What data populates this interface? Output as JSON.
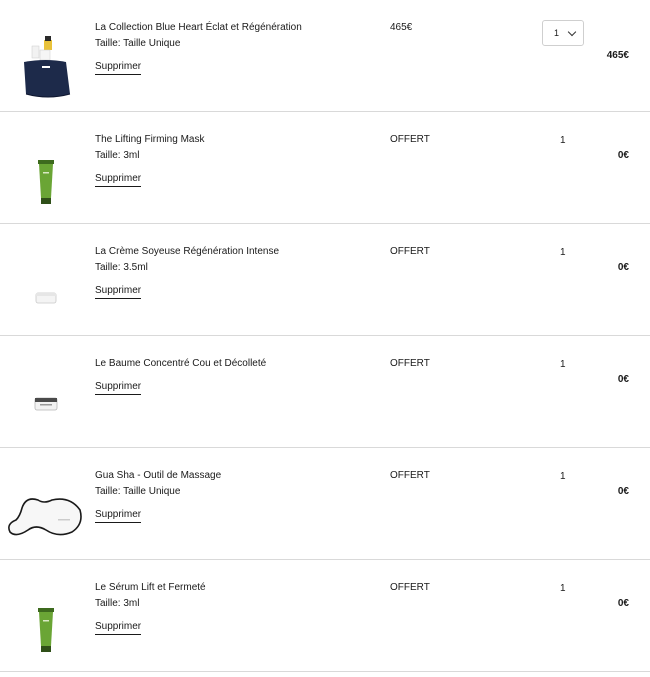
{
  "cart": {
    "items": [
      {
        "name": "La Collection Blue Heart Éclat et Régénération",
        "size": "Taille: Taille Unique",
        "remove_label": "Supprimer",
        "unit_price": "465€",
        "quantity": "1",
        "total": "465€",
        "image_icon": "gift-set-pouch-icon"
      },
      {
        "name": "The Lifting Firming Mask",
        "size": "Taille: 3ml",
        "remove_label": "Supprimer",
        "unit_price": "OFFERT",
        "quantity": "1",
        "total": "0€",
        "image_icon": "green-tube-icon"
      },
      {
        "name": "La Crème Soyeuse Régénération Intense",
        "size": "Taille: 3.5ml",
        "remove_label": "Supprimer",
        "unit_price": "OFFERT",
        "quantity": "1",
        "total": "0€",
        "image_icon": "cream-jar-icon"
      },
      {
        "name": "Le Baume Concentré Cou et Décolleté",
        "size": "",
        "remove_label": "Supprimer",
        "unit_price": "OFFERT",
        "quantity": "1",
        "total": "0€",
        "image_icon": "balm-jar-icon"
      },
      {
        "name": "Gua Sha - Outil de Massage",
        "size": "Taille: Taille Unique",
        "remove_label": "Supprimer",
        "unit_price": "OFFERT",
        "quantity": "1",
        "total": "0€",
        "image_icon": "gua-sha-tool-icon"
      },
      {
        "name": "Le Sérum Lift et Fermeté",
        "size": "Taille: 3ml",
        "remove_label": "Supprimer",
        "unit_price": "OFFERT",
        "quantity": "1",
        "total": "0€",
        "image_icon": "green-tube-icon"
      }
    ]
  }
}
